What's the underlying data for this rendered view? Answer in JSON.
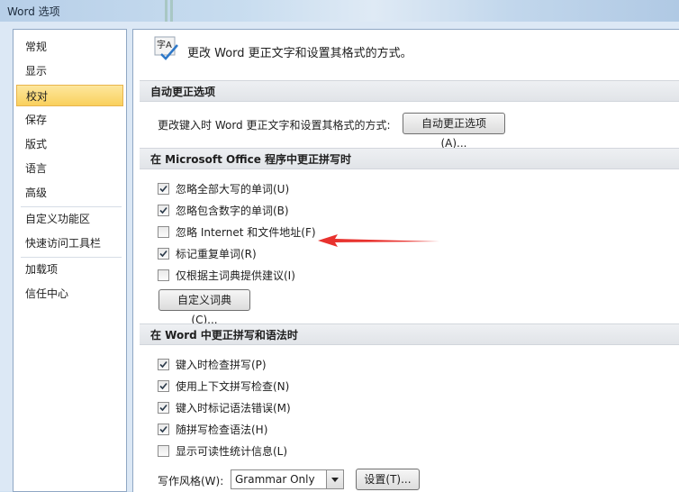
{
  "window": {
    "title": "Word 选项"
  },
  "sidebar": {
    "items": [
      {
        "label": "常规"
      },
      {
        "label": "显示"
      },
      {
        "label": "校对",
        "active": true
      },
      {
        "label": "保存"
      },
      {
        "label": "版式"
      },
      {
        "label": "语言"
      },
      {
        "label": "高级"
      },
      {
        "label": "自定义功能区"
      },
      {
        "label": "快速访问工具栏"
      },
      {
        "label": "加载项"
      },
      {
        "label": "信任中心"
      }
    ]
  },
  "intro": {
    "text": "更改 Word 更正文字和设置其格式的方式。",
    "icon": "abc-check-icon",
    "icon_text": "字A"
  },
  "autocorrect": {
    "header": "自动更正选项",
    "description": "更改键入时 Word 更正文字和设置其格式的方式:",
    "button": "自动更正选项(A)..."
  },
  "office_spelling": {
    "header": "在 Microsoft Office 程序中更正拼写时",
    "options": [
      {
        "label": "忽略全部大写的单词(U)",
        "checked": true
      },
      {
        "label": "忽略包含数字的单词(B)",
        "checked": true
      },
      {
        "label": "忽略 Internet 和文件地址(F)",
        "checked": false
      },
      {
        "label": "标记重复单词(R)",
        "checked": true
      },
      {
        "label": "仅根据主词典提供建议(I)",
        "checked": false
      }
    ],
    "dictionary_button": "自定义词典(C)..."
  },
  "word_spelling": {
    "header": "在 Word 中更正拼写和语法时",
    "options": [
      {
        "label": "键入时检查拼写(P)",
        "checked": true
      },
      {
        "label": "使用上下文拼写检查(N)",
        "checked": true
      },
      {
        "label": "键入时标记语法错误(M)",
        "checked": true
      },
      {
        "label": "随拼写检查语法(H)",
        "checked": true
      },
      {
        "label": "显示可读性统计信息(L)",
        "checked": false
      }
    ],
    "style_label": "写作风格(W):",
    "style_value": "Grammar Only",
    "settings_button": "设置(T)..."
  },
  "colors": {
    "annotation_arrow": "#e8322e",
    "active_nav": "#f9d05d"
  }
}
